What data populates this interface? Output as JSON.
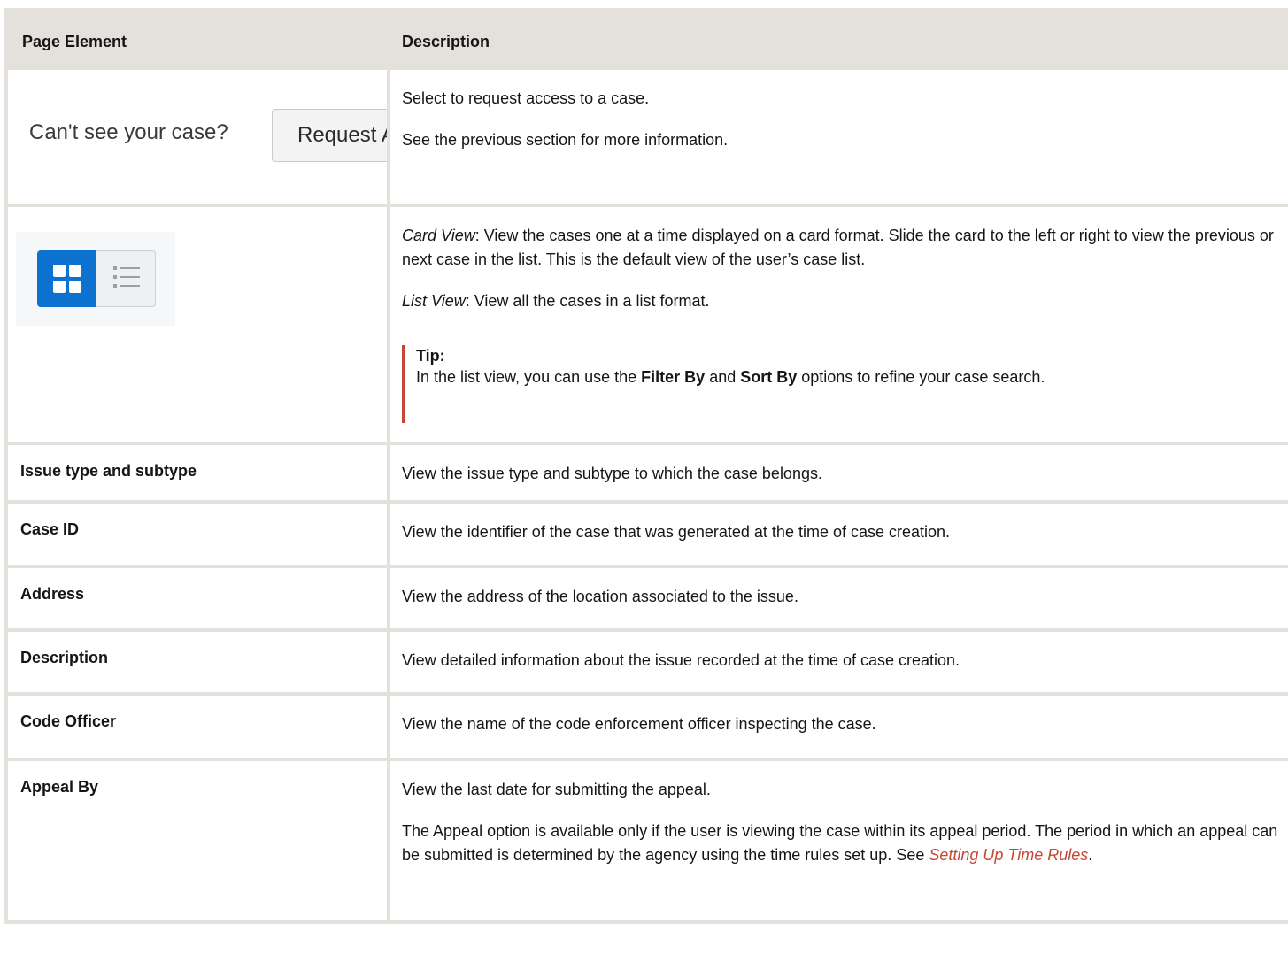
{
  "header": {
    "col1": "Page Element",
    "col2": "Description"
  },
  "rows": {
    "request": {
      "snippet_prompt": "Can't see your case?",
      "snippet_button": "Request A",
      "desc_p1": "Select to request access to a case.",
      "desc_p2": "See the previous section for more information."
    },
    "views": {
      "icons": [
        "card-view-icon",
        "list-view-icon"
      ],
      "colors": {
        "active": "#0d72cf",
        "inactive": "#eef0f1"
      },
      "card_term": "Card View",
      "card_text": ": View the cases one at a time displayed on a card format. Slide the card to the left or right to view the previous or next case in the list. This is the default view of the user’s case list.",
      "list_term": "List View",
      "list_text": ": View all the cases in a list format.",
      "tip_title": "Tip:",
      "tip_pre": "In the list view, you can use the ",
      "tip_b1": "Filter By",
      "tip_mid": " and ",
      "tip_b2": "Sort By",
      "tip_post": " options to refine your case search."
    },
    "issue": {
      "label": "Issue type and subtype",
      "desc": "View the issue type and subtype to which the case belongs."
    },
    "case_id": {
      "label": "Case ID",
      "desc": "View the identifier of the case that was generated at the time of case creation."
    },
    "address": {
      "label": "Address",
      "desc": "View the address of the location associated to the issue."
    },
    "description": {
      "label": "Description",
      "desc": "View detailed information about the issue recorded at the time of case creation."
    },
    "officer": {
      "label": "Code Officer",
      "desc": "View the name of the code enforcement officer inspecting the case."
    },
    "appeal": {
      "label": "Appeal By",
      "desc_p1": "View the last date for submitting the appeal.",
      "desc_p2": "The Appeal option is available only if the user is viewing the case within its appeal period. The period in which an appeal can be submitted is determined by the agency using the time rules set up. See ",
      "link": "Setting Up Time Rules",
      "desc_p2_end": "."
    }
  },
  "colors": {
    "header_bg": "#e4e1dd",
    "link": "#c74634",
    "tip_bar": "#c74634"
  }
}
